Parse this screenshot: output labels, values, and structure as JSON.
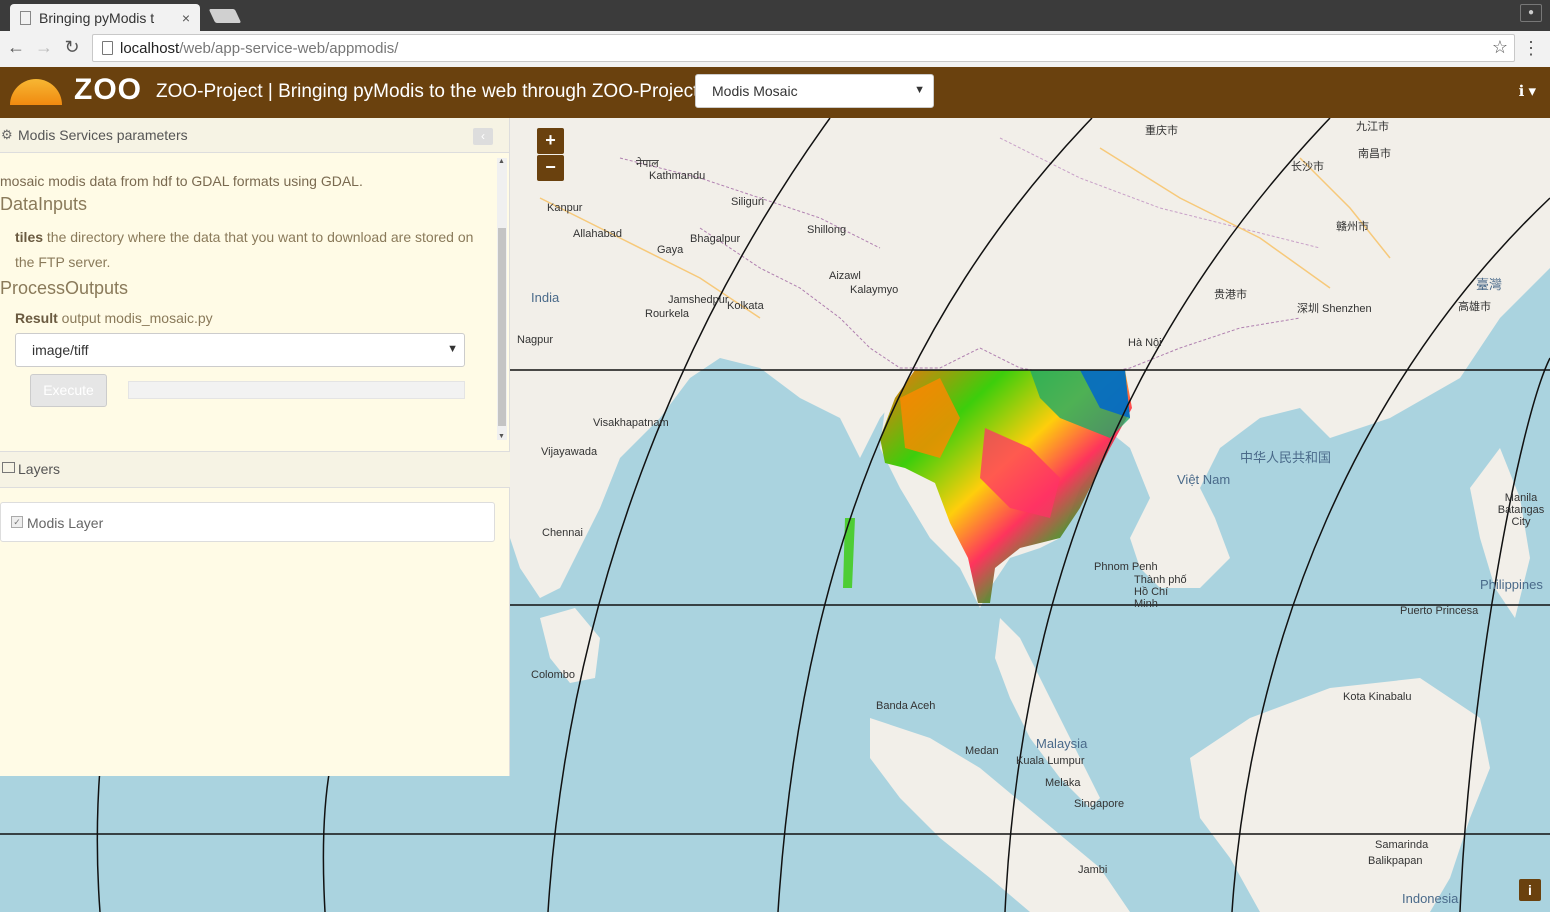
{
  "browser": {
    "tab_title": "Bringing pyModis t",
    "tab_close": "×",
    "url_host": "localhost",
    "url_path": "/web/app-service-web/appmodis/"
  },
  "app": {
    "logo_text": "ZOO",
    "title": "ZOO-Project | Bringing pyModis to the web through ZOO-Project",
    "service_select": "Modis Mosaic",
    "info_icon": "ℹ ▾"
  },
  "panel": {
    "title": "Modis Services parameters",
    "description": "mosaic modis data from hdf to GDAL formats using GDAL.",
    "data_inputs_heading": "DataInputs",
    "input_name": "tiles",
    "input_desc": " the directory where the data that you want to download are stored on the FTP server.",
    "process_outputs_heading": "ProcessOutputs",
    "result_name": "Result",
    "result_desc": " output modis_mosaic.py",
    "format_value": "image/tiff",
    "execute_label": "Execute",
    "collapse_icon": "‹"
  },
  "layers": {
    "title": "Layers",
    "items": [
      {
        "label": "Modis Layer",
        "checked": true
      }
    ]
  },
  "map": {
    "zoom_in": "+",
    "zoom_out": "−",
    "attribution": "i",
    "labels": [
      {
        "text": "Kathmandu"
      },
      {
        "text": "नेपाल"
      },
      {
        "text": "Kanpur"
      },
      {
        "text": "Allahabad"
      },
      {
        "text": "Gaya"
      },
      {
        "text": "Bhagalpur"
      },
      {
        "text": "Siliguri"
      },
      {
        "text": "Shillong"
      },
      {
        "text": "Aizawl"
      },
      {
        "text": "Kalaymyo"
      },
      {
        "text": "Jamshedpur"
      },
      {
        "text": "Kolkata"
      },
      {
        "text": "Rourkela"
      },
      {
        "text": "India"
      },
      {
        "text": "Nagpur"
      },
      {
        "text": "Visakhapatnam"
      },
      {
        "text": "Vijayawada"
      },
      {
        "text": "Chennai"
      },
      {
        "text": "Colombo"
      },
      {
        "text": "Hà Nội"
      },
      {
        "text": "重庆市"
      },
      {
        "text": "贵港市"
      },
      {
        "text": "深圳 Shenzhen"
      },
      {
        "text": "中华人民共和国"
      },
      {
        "text": "Việt Nam"
      },
      {
        "text": "Phnom Penh"
      },
      {
        "text": "Thành phố Hồ Chí Minh"
      },
      {
        "text": "Banda Aceh"
      },
      {
        "text": "Medan"
      },
      {
        "text": "Malaysia"
      },
      {
        "text": "Kuala Lumpur"
      },
      {
        "text": "Melaka"
      },
      {
        "text": "Singapore"
      },
      {
        "text": "Jambi"
      },
      {
        "text": "Kota Kinabalu"
      },
      {
        "text": "Samarinda"
      },
      {
        "text": "Balikpapan"
      },
      {
        "text": "Indonesia"
      },
      {
        "text": "Puerto Princesa"
      },
      {
        "text": "Manila Batangas City"
      },
      {
        "text": "Philippines"
      },
      {
        "text": "高雄市"
      },
      {
        "text": "臺灣"
      },
      {
        "text": "南昌市"
      },
      {
        "text": "长沙市"
      },
      {
        "text": "九江市"
      },
      {
        "text": "赣州市"
      }
    ]
  },
  "colors": {
    "brand": "#6a410e",
    "sea": "#aad3df",
    "land": "#f2efe9",
    "panel_bg": "#fffbe6"
  }
}
